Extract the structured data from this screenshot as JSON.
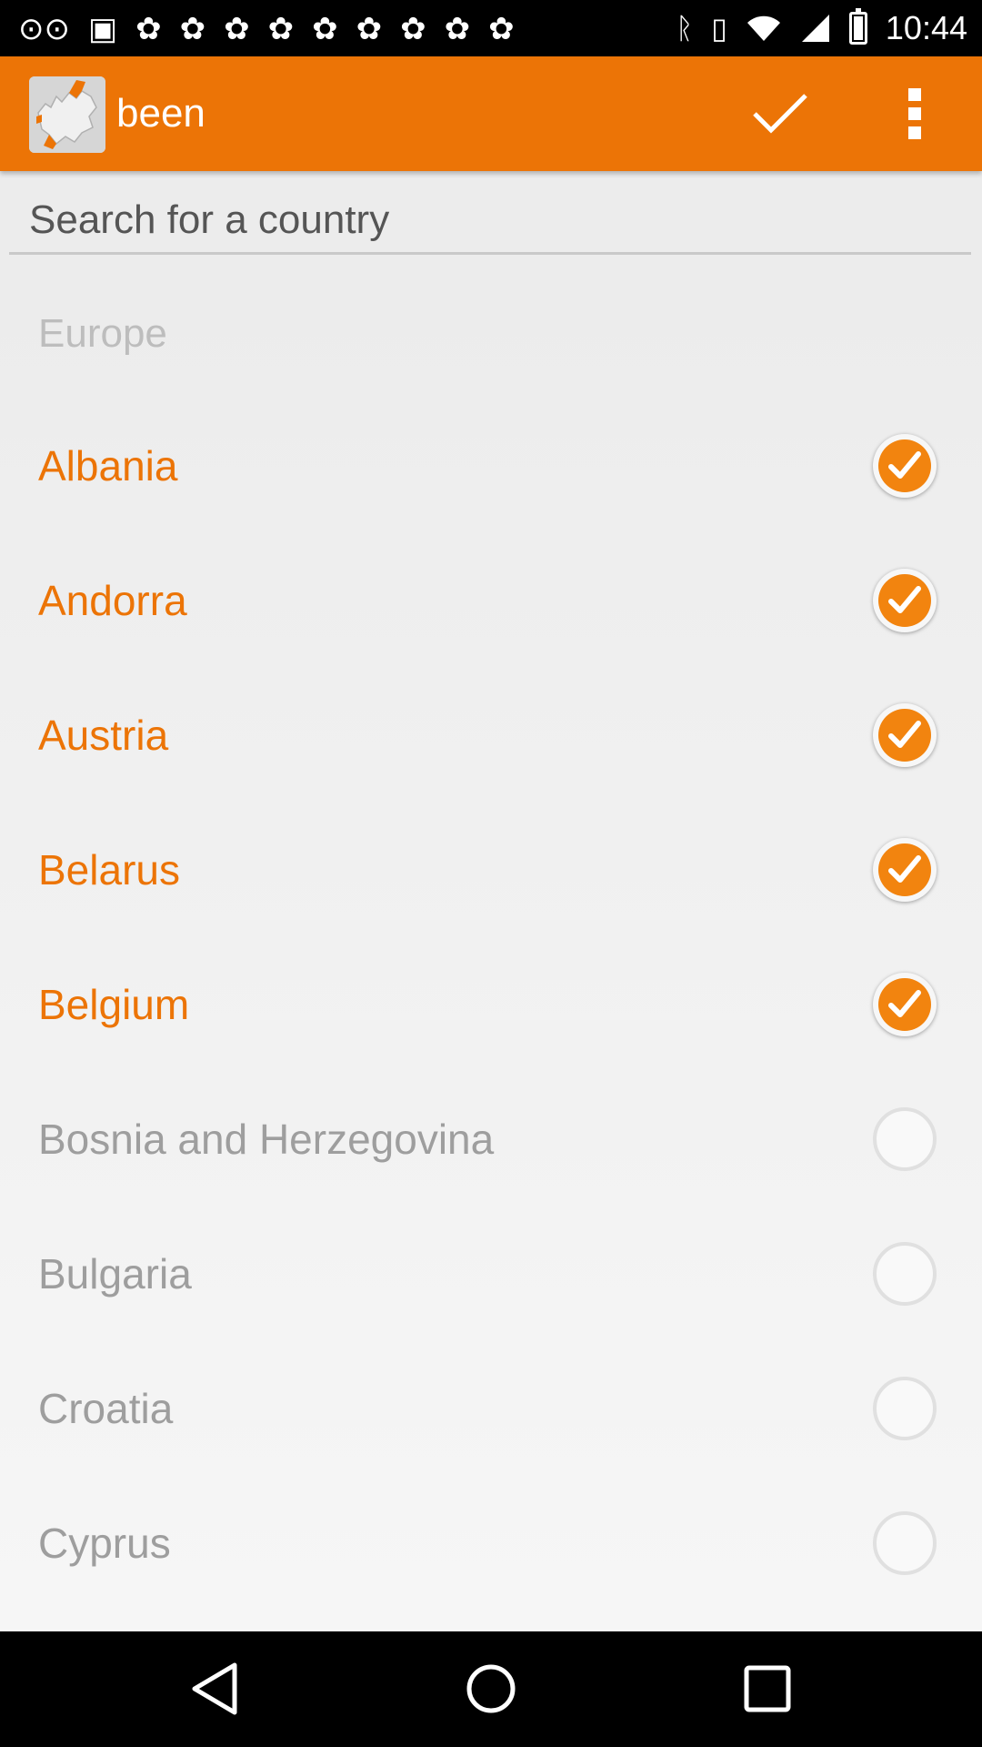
{
  "status_bar": {
    "time": "10:44",
    "notification_icons": [
      "voicemail-icon",
      "image-icon",
      "pinwheel-icon",
      "pinwheel-icon",
      "pinwheel-icon",
      "pinwheel-icon",
      "pinwheel-icon",
      "pinwheel-icon",
      "pinwheel-icon",
      "pinwheel-icon",
      "pinwheel-icon"
    ],
    "system_icons": [
      "bluetooth-icon",
      "vibrate-icon",
      "wifi-icon",
      "signal-icon",
      "battery-icon"
    ]
  },
  "app_bar": {
    "title": "been",
    "background": "#ec7406",
    "logo_icon": "europe-map-icon",
    "actions": [
      "check-icon",
      "overflow-menu-icon"
    ]
  },
  "search": {
    "placeholder": "Search for a country",
    "value": ""
  },
  "list": {
    "section": "Europe",
    "accent_color": "#ec7406",
    "countries": [
      {
        "name": "Albania",
        "checked": true
      },
      {
        "name": "Andorra",
        "checked": true
      },
      {
        "name": "Austria",
        "checked": true
      },
      {
        "name": "Belarus",
        "checked": true
      },
      {
        "name": "Belgium",
        "checked": true
      },
      {
        "name": "Bosnia and Herzegovina",
        "checked": false
      },
      {
        "name": "Bulgaria",
        "checked": false
      },
      {
        "name": "Croatia",
        "checked": false
      },
      {
        "name": "Cyprus",
        "checked": false
      }
    ]
  },
  "nav_bar": {
    "buttons": [
      "back-icon",
      "home-icon",
      "recents-icon"
    ]
  }
}
